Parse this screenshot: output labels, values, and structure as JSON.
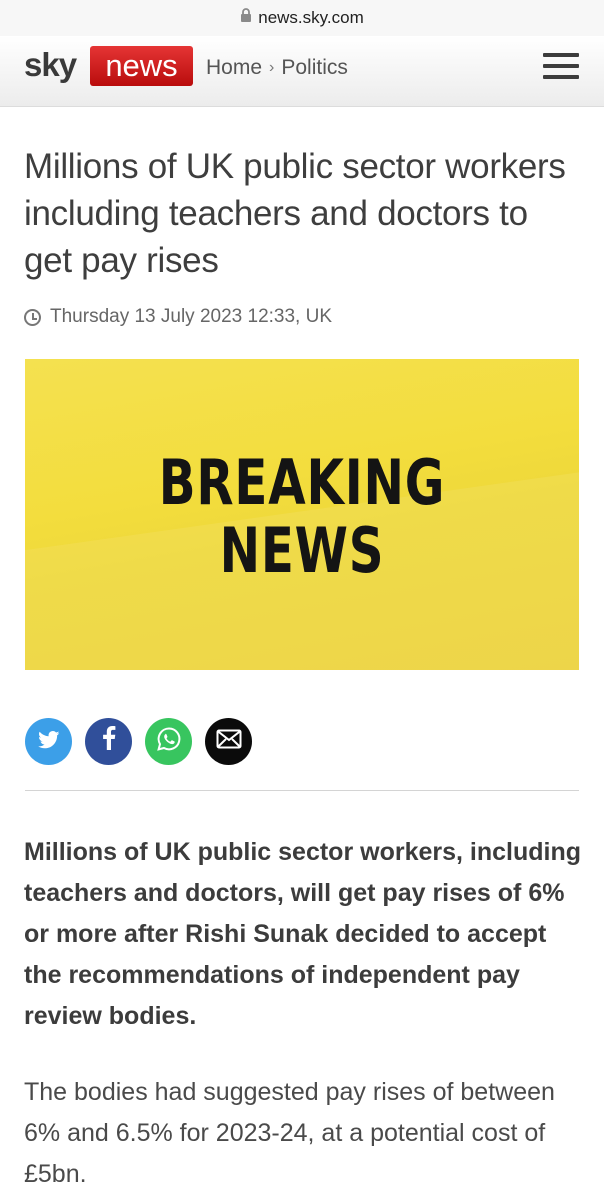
{
  "browser": {
    "url": "news.sky.com"
  },
  "header": {
    "logo_sky": "sky",
    "logo_news": "news",
    "breadcrumb": [
      "Home",
      "Politics"
    ],
    "breadcrumb_separator": "›"
  },
  "article": {
    "headline": "Millions of UK public sector workers including teachers and doctors to get pay rises",
    "timestamp": "Thursday 13 July 2023 12:33, UK",
    "hero": {
      "line1": "BREAKING",
      "line2": "NEWS"
    },
    "intro": "Millions of UK public sector workers, including teachers and doctors, will get pay rises of 6% or more after Rishi Sunak decided to accept the recommendations of independent pay review bodies.",
    "paragraph1": "The bodies had suggested pay rises of between 6% and 6.5% for 2023-24, at a potential cost of £5bn."
  },
  "share": {
    "buttons": [
      {
        "name": "twitter",
        "icon": "twitter-icon",
        "color": "#3c9fe8"
      },
      {
        "name": "facebook",
        "icon": "facebook-icon",
        "color": "#304f9a"
      },
      {
        "name": "whatsapp",
        "icon": "whatsapp-icon",
        "color": "#38c55f"
      },
      {
        "name": "email",
        "icon": "email-icon",
        "color": "#0b0b0b"
      }
    ]
  },
  "colors": {
    "brand_red": "#c8161b",
    "hero_yellow": "#f3dd3d"
  }
}
